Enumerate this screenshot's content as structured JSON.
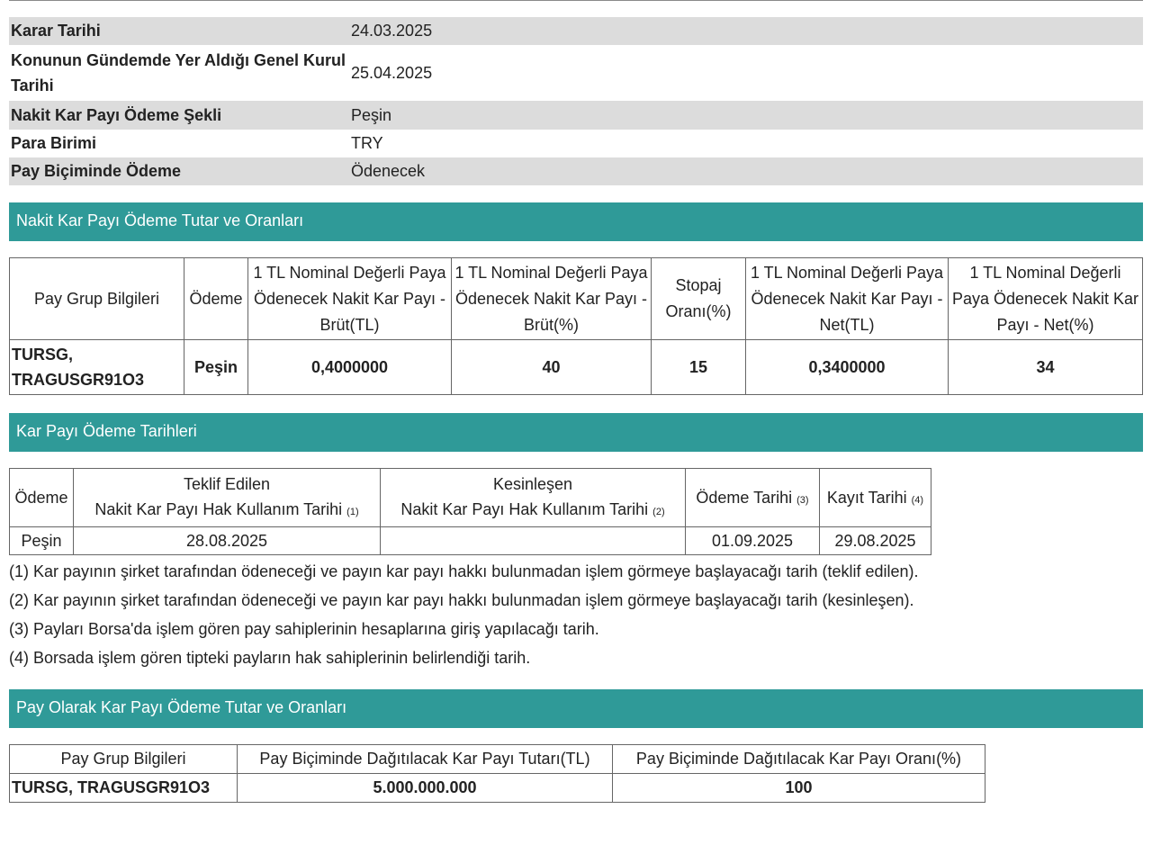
{
  "info_rows": [
    {
      "label": "Karar Tarihi",
      "value": "24.03.2025"
    },
    {
      "label": "Konunun Gündemde Yer Aldığı Genel Kurul Tarihi",
      "value": "25.04.2025"
    },
    {
      "label": "Nakit Kar Payı Ödeme Şekli",
      "value": "Peşin"
    },
    {
      "label": "Para Birimi",
      "value": "TRY"
    },
    {
      "label": "Pay Biçiminde Ödeme",
      "value": "Ödenecek"
    }
  ],
  "section1": {
    "title": "Nakit Kar Payı Ödeme Tutar ve Oranları",
    "headers": [
      "Pay Grup Bilgileri",
      "Ödeme",
      "1 TL Nominal Değerli Paya Ödenecek Nakit Kar Payı - Brüt(TL)",
      "1 TL Nominal Değerli Paya Ödenecek Nakit Kar Payı - Brüt(%)",
      "Stopaj Oranı(%)",
      "1 TL Nominal Değerli Paya Ödenecek Nakit Kar Payı - Net(TL)",
      "1 TL Nominal Değerli Paya Ödenecek Nakit Kar Payı - Net(%)"
    ],
    "row": [
      "TURSG, TRAGUSGR91O3",
      "Peşin",
      "0,4000000",
      "40",
      "15",
      "0,3400000",
      "34"
    ]
  },
  "section2": {
    "title": "Kar Payı Ödeme Tarihleri",
    "h_odeme": "Ödeme",
    "h_teklif_top": "Teklif Edilen",
    "h_teklif_bottom": "Nakit Kar Payı Hak Kullanım Tarihi",
    "h_teklif_ref": "(1)",
    "h_kesin_top": "Kesinleşen",
    "h_kesin_bottom": "Nakit Kar Payı Hak Kullanım Tarihi",
    "h_kesin_ref": "(2)",
    "h_odeme_tarihi": "Ödeme Tarihi",
    "h_odeme_tarihi_ref": "(3)",
    "h_kayit_tarihi": "Kayıt Tarihi",
    "h_kayit_tarihi_ref": "(4)",
    "row": [
      "Peşin",
      "28.08.2025",
      "",
      "01.09.2025",
      "29.08.2025"
    ],
    "notes": [
      "(1) Kar payının şirket tarafından ödeneceği ve payın kar payı hakkı bulunmadan işlem görmeye başlayacağı tarih (teklif edilen).",
      "(2) Kar payının şirket tarafından ödeneceği ve payın kar payı hakkı bulunmadan işlem görmeye başlayacağı tarih (kesinleşen).",
      "(3) Payları Borsa'da işlem gören pay sahiplerinin hesaplarına giriş yapılacağı tarih.",
      "(4) Borsada işlem gören tipteki payların hak sahiplerinin belirlendiği tarih."
    ]
  },
  "section3": {
    "title": "Pay Olarak Kar Payı Ödeme Tutar ve Oranları",
    "headers": [
      "Pay Grup Bilgileri",
      "Pay Biçiminde Dağıtılacak Kar Payı Tutarı(TL)",
      "Pay Biçiminde Dağıtılacak Kar Payı Oranı(%)"
    ],
    "row": [
      "TURSG, TRAGUSGR91O3",
      "5.000.000.000",
      "100"
    ]
  }
}
